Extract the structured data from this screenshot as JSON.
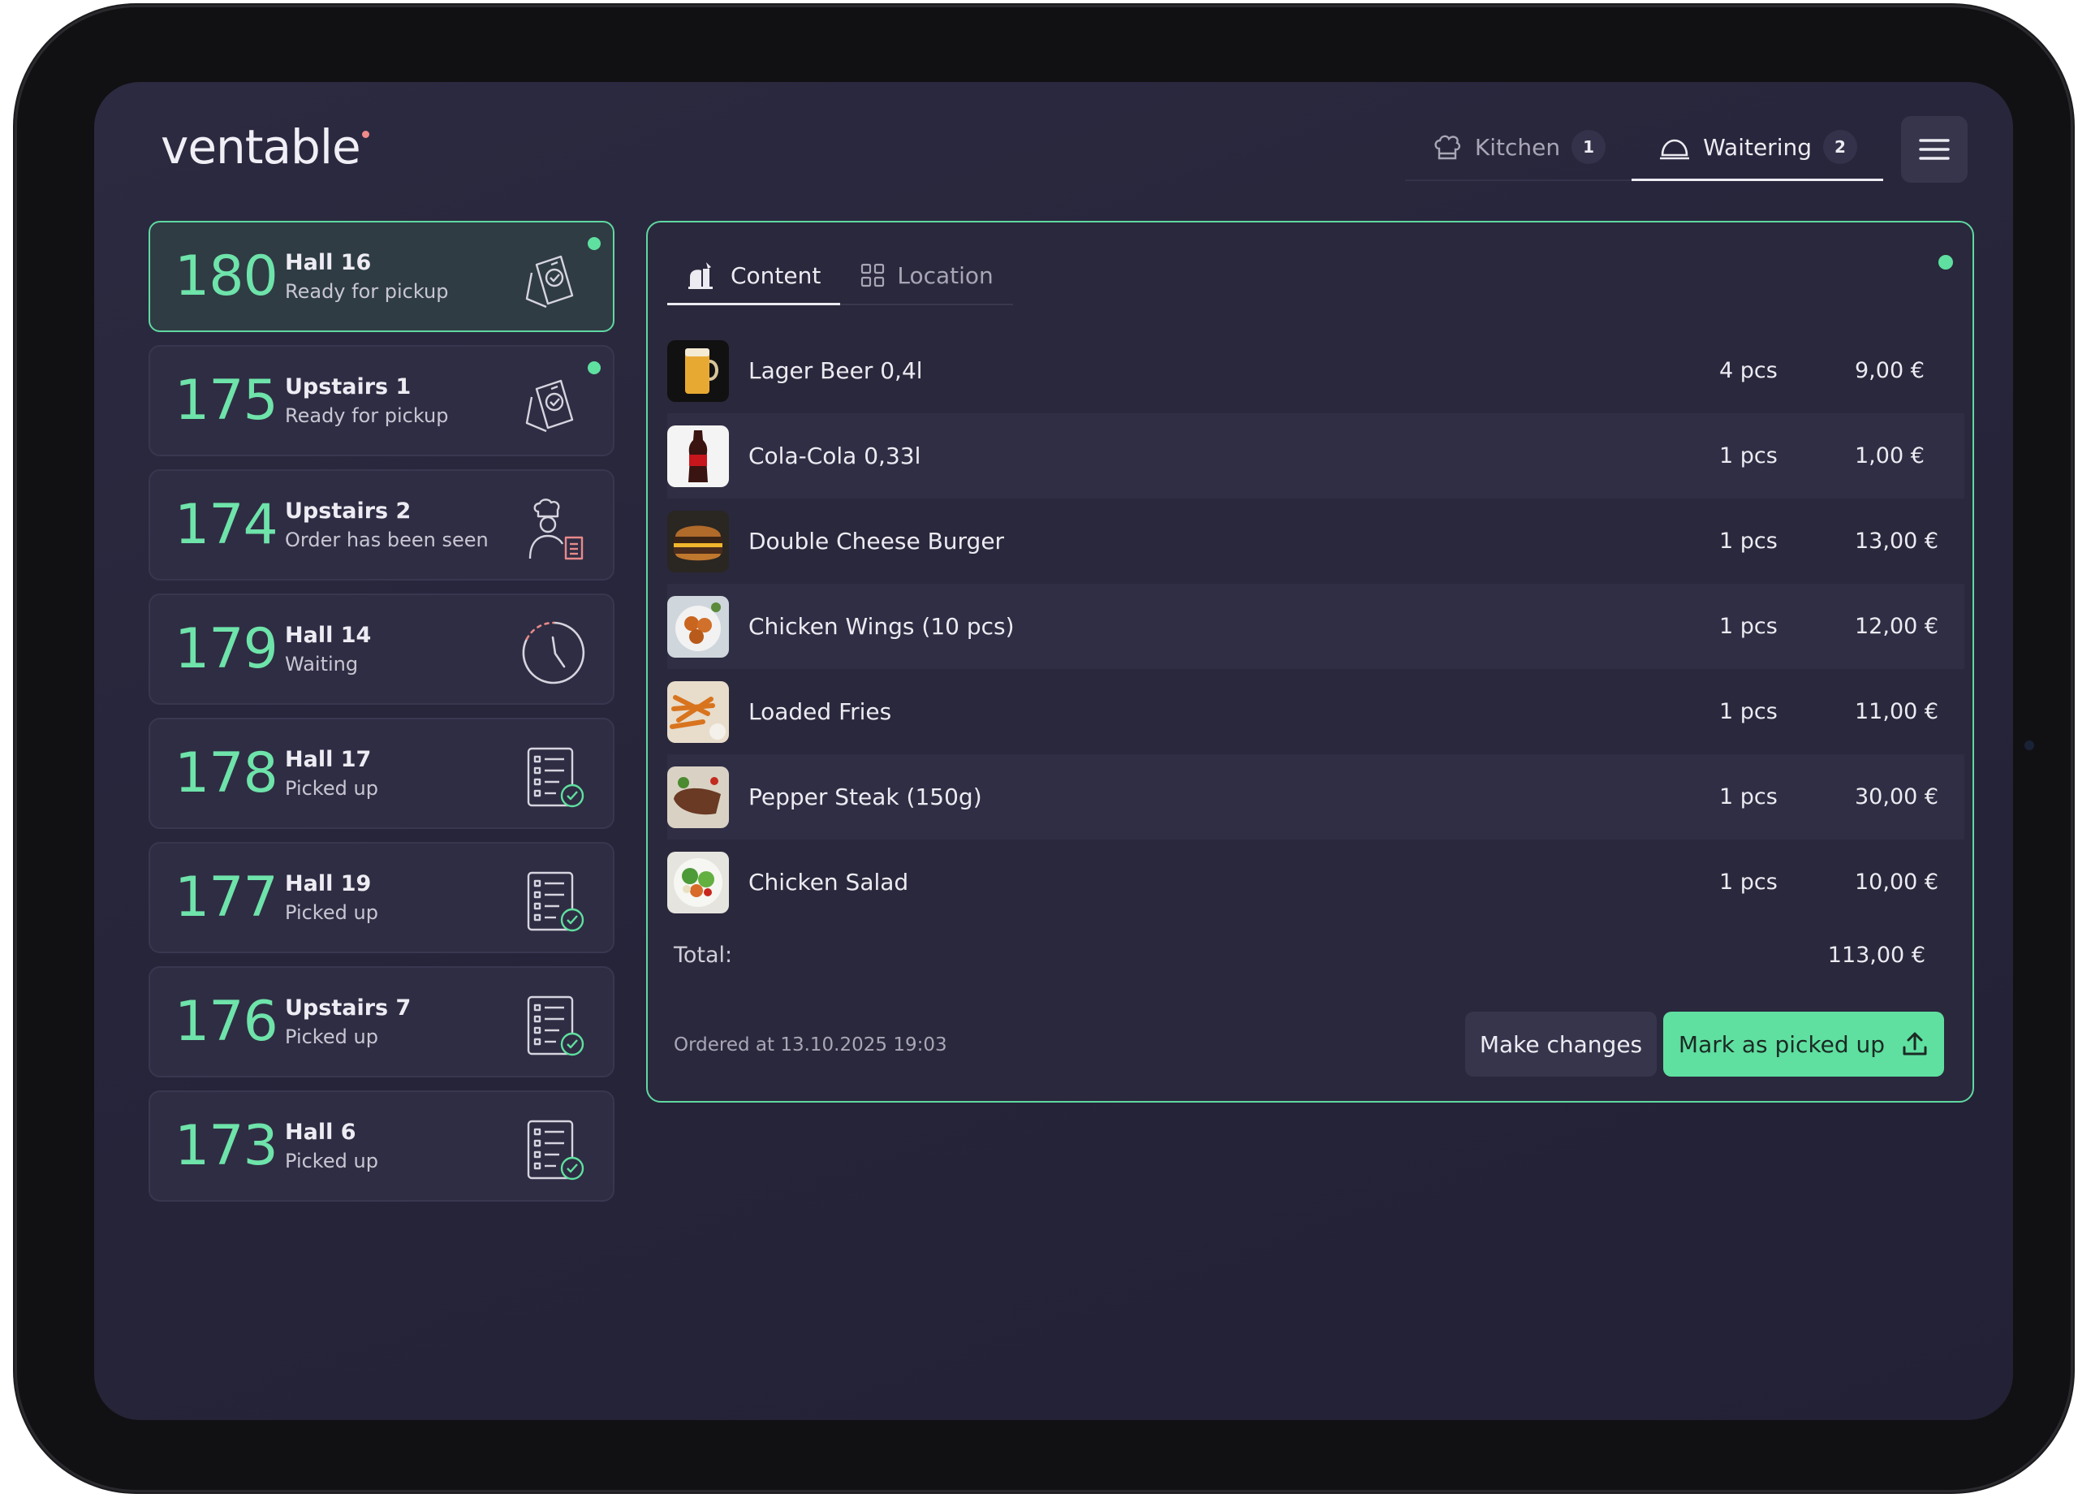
{
  "app": {
    "logo_text": "ventable"
  },
  "nav": {
    "tabs": [
      {
        "label": "Kitchen",
        "count": "1",
        "icon": "chef-hat-icon",
        "active": false
      },
      {
        "label": "Waitering",
        "count": "2",
        "icon": "cloche-icon",
        "active": true
      }
    ],
    "menu_icon": "hamburger-menu-icon"
  },
  "orders": [
    {
      "number": "180",
      "location": "Hall 16",
      "status": "Ready for pickup",
      "icon": "phone-ready-icon",
      "new": true,
      "selected": true
    },
    {
      "number": "175",
      "location": "Upstairs 1",
      "status": "Ready for pickup",
      "icon": "phone-ready-icon",
      "new": true,
      "selected": false
    },
    {
      "number": "174",
      "location": "Upstairs 2",
      "status": "Order has been seen",
      "icon": "chef-order-icon",
      "new": false,
      "selected": false
    },
    {
      "number": "179",
      "location": "Hall 14",
      "status": "Waiting",
      "icon": "clock-icon",
      "new": false,
      "selected": false
    },
    {
      "number": "178",
      "location": "Hall 17",
      "status": "Picked up",
      "icon": "checklist-done-icon",
      "new": false,
      "selected": false
    },
    {
      "number": "177",
      "location": "Hall 19",
      "status": "Picked up",
      "icon": "checklist-done-icon",
      "new": false,
      "selected": false
    },
    {
      "number": "176",
      "location": "Upstairs 7",
      "status": "Picked up",
      "icon": "checklist-done-icon",
      "new": false,
      "selected": false
    },
    {
      "number": "173",
      "location": "Hall 6",
      "status": "Picked up",
      "icon": "checklist-done-icon",
      "new": false,
      "selected": false
    }
  ],
  "detail": {
    "tabs": [
      {
        "label": "Content",
        "icon": "food-tray-icon",
        "active": true
      },
      {
        "label": "Location",
        "icon": "grid-icon",
        "active": false
      }
    ],
    "items": [
      {
        "name": "Lager Beer 0,4l",
        "qty": "4 pcs",
        "price": "9,00 €",
        "thumb": "beer"
      },
      {
        "name": "Cola-Cola 0,33l",
        "qty": "1 pcs",
        "price": "1,00 €",
        "thumb": "cola"
      },
      {
        "name": "Double Cheese Burger",
        "qty": "1 pcs",
        "price": "13,00 €",
        "thumb": "burger"
      },
      {
        "name": "Chicken Wings (10 pcs)",
        "qty": "1 pcs",
        "price": "12,00 €",
        "thumb": "wings"
      },
      {
        "name": "Loaded Fries",
        "qty": "1 pcs",
        "price": "11,00 €",
        "thumb": "fries"
      },
      {
        "name": "Pepper Steak (150g)",
        "qty": "1 pcs",
        "price": "30,00 €",
        "thumb": "steak"
      },
      {
        "name": "Chicken Salad",
        "qty": "1 pcs",
        "price": "10,00 €",
        "thumb": "salad"
      }
    ],
    "total_label": "Total:",
    "total_value": "113,00 €",
    "ordered_at": "Ordered at 13.10.2025 19:03",
    "make_changes_label": "Make changes",
    "mark_picked_label": "Mark as picked up"
  },
  "colors": {
    "accent": "#5fe0a0",
    "background": "#27253a",
    "card": "#2f2d43"
  }
}
